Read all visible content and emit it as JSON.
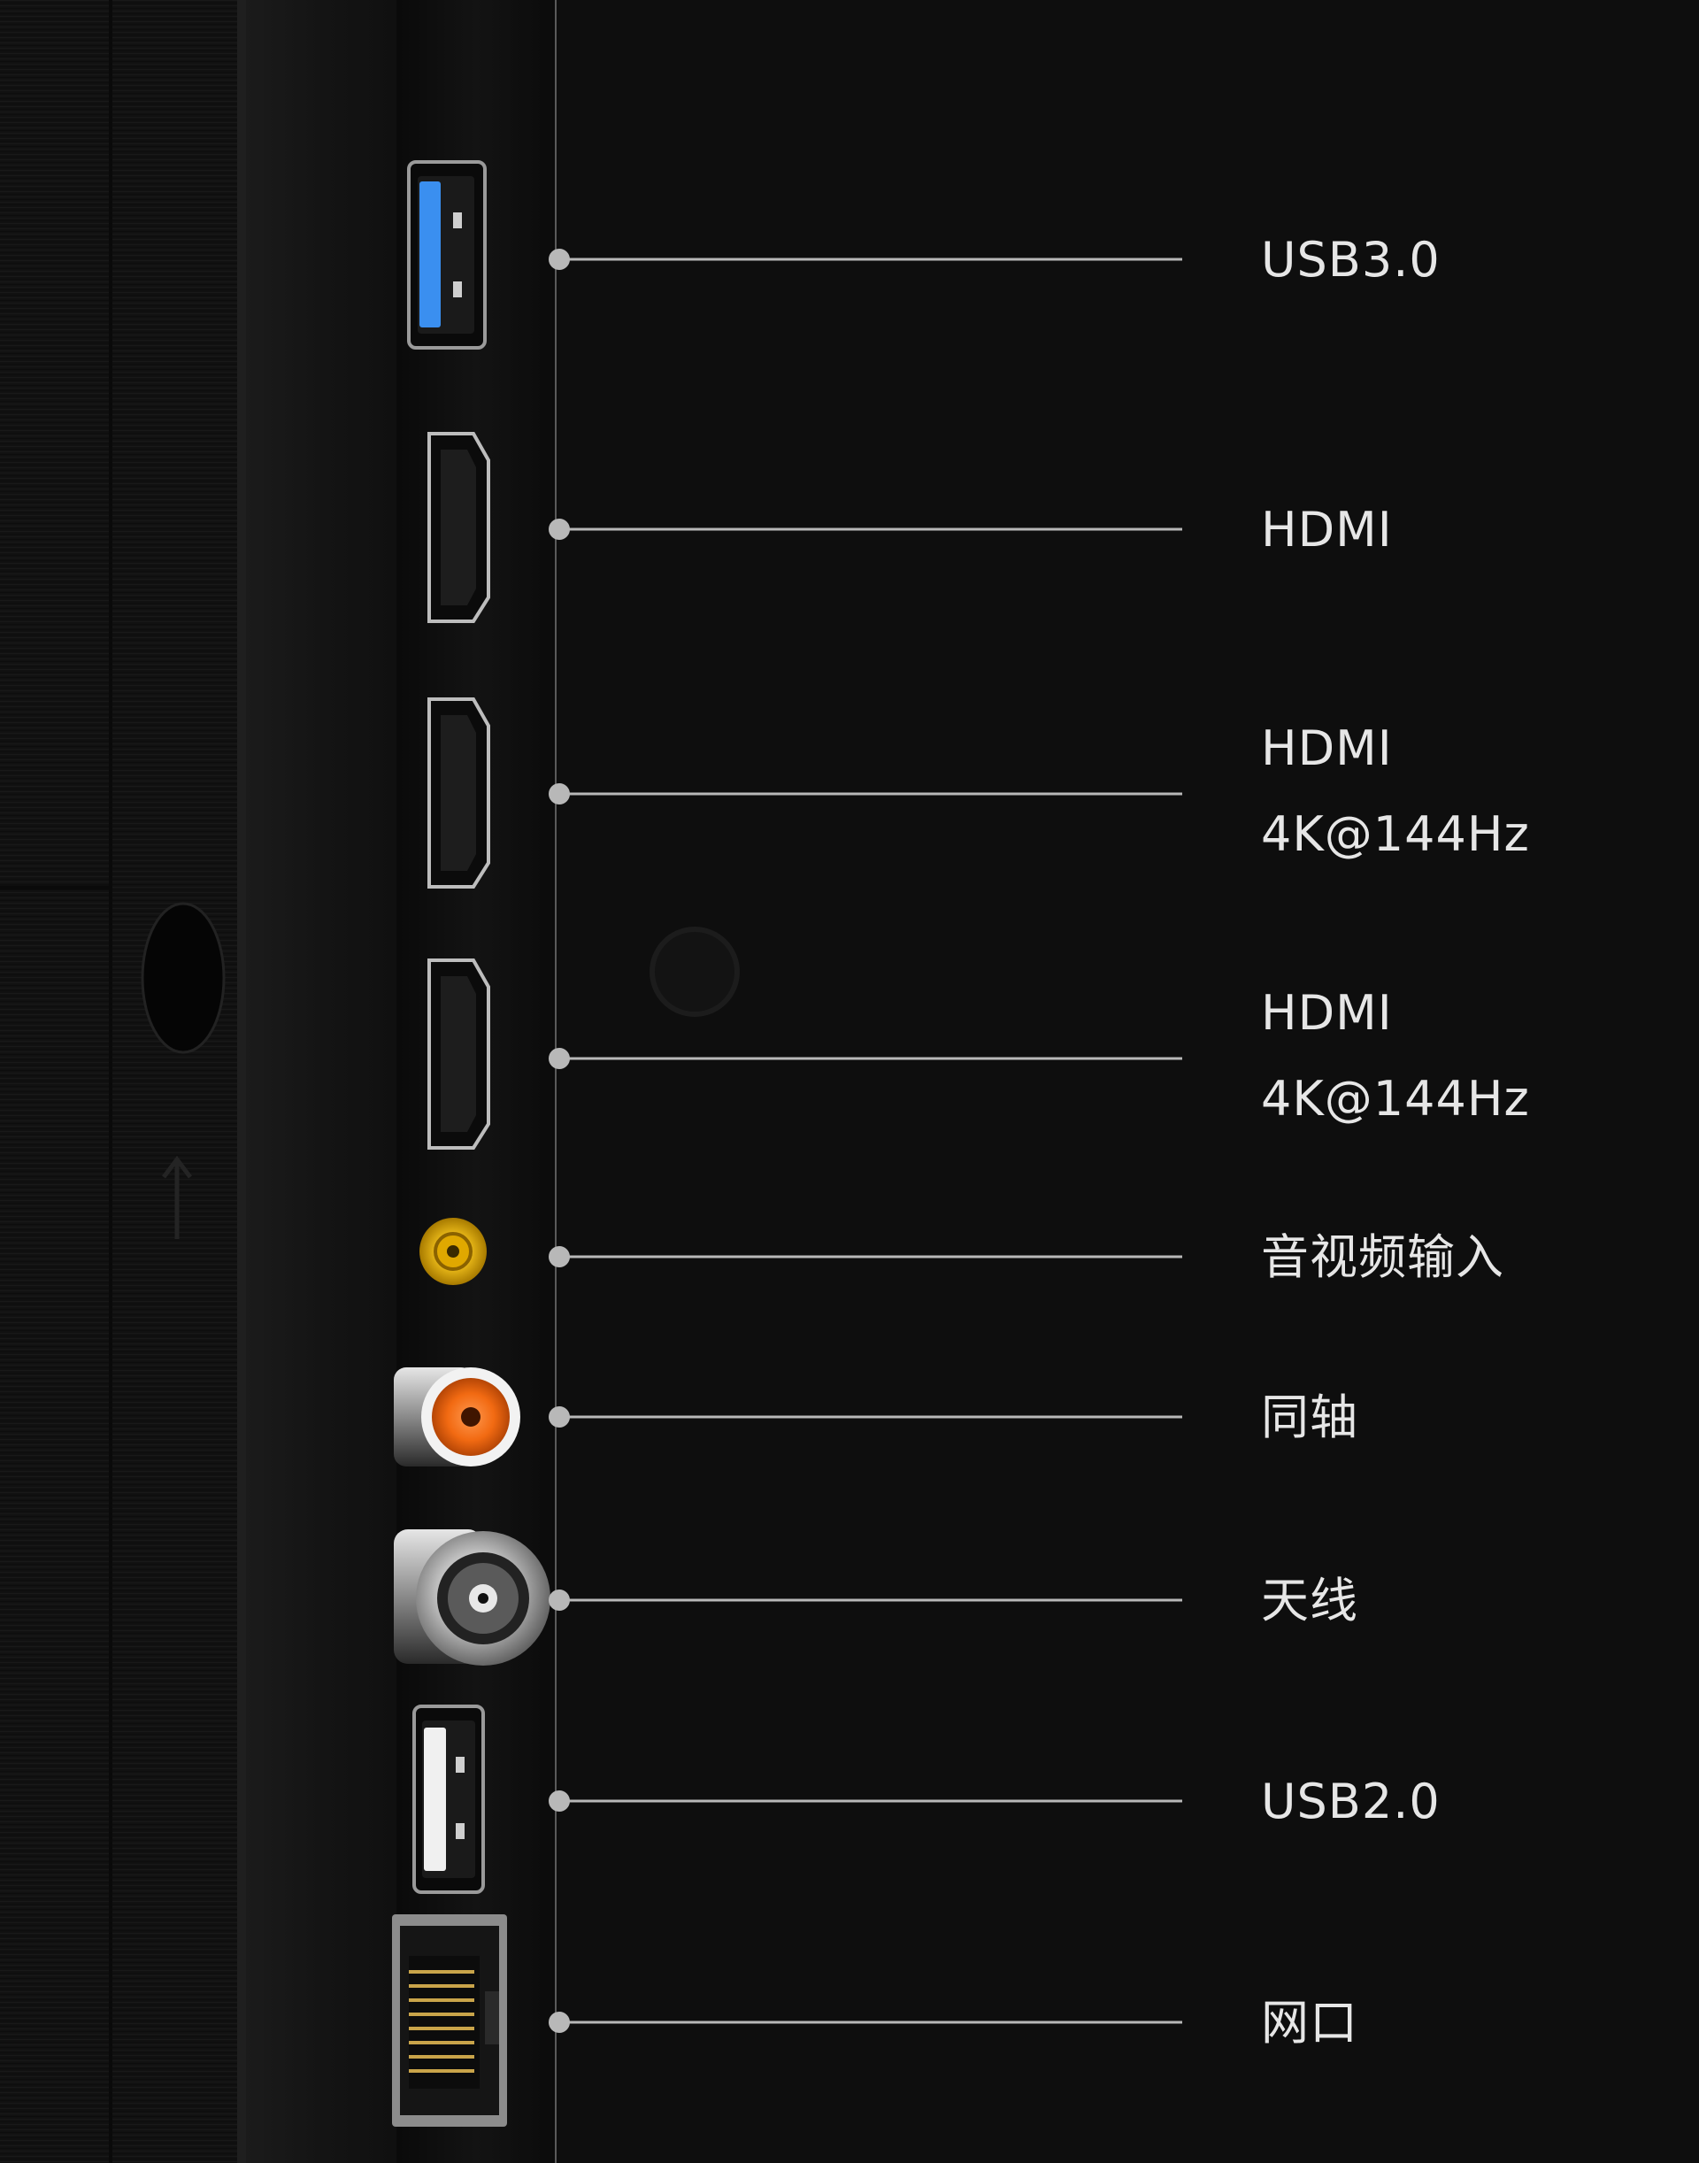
{
  "colors": {
    "background": "#0e0e0e",
    "panel": "#141414",
    "leader_line": "#b8b8b8",
    "label_text": "#e6e6e6",
    "usb3_accent": "#3a8ff0",
    "av_input": "#f3c21c",
    "coaxial": "#f26a12"
  },
  "ports": [
    {
      "id": "usb3",
      "icon": "usb3-port-icon",
      "lines": [
        "USB3.0"
      ]
    },
    {
      "id": "hdmi1",
      "icon": "hdmi-port-icon",
      "lines": [
        "HDMI"
      ]
    },
    {
      "id": "hdmi2",
      "icon": "hdmi-port-icon",
      "lines": [
        "HDMI",
        "4K@144Hz"
      ]
    },
    {
      "id": "hdmi3",
      "icon": "hdmi-port-icon",
      "lines": [
        "HDMI",
        "4K@144Hz"
      ]
    },
    {
      "id": "av",
      "icon": "av-input-jack-icon",
      "lines": [
        "音视频输入"
      ]
    },
    {
      "id": "coax",
      "icon": "coaxial-jack-icon",
      "lines": [
        "同轴"
      ]
    },
    {
      "id": "antenna",
      "icon": "antenna-jack-icon",
      "lines": [
        "天线"
      ]
    },
    {
      "id": "usb2",
      "icon": "usb2-port-icon",
      "lines": [
        "USB2.0"
      ]
    },
    {
      "id": "lan",
      "icon": "ethernet-port-icon",
      "lines": [
        "网口"
      ]
    }
  ]
}
